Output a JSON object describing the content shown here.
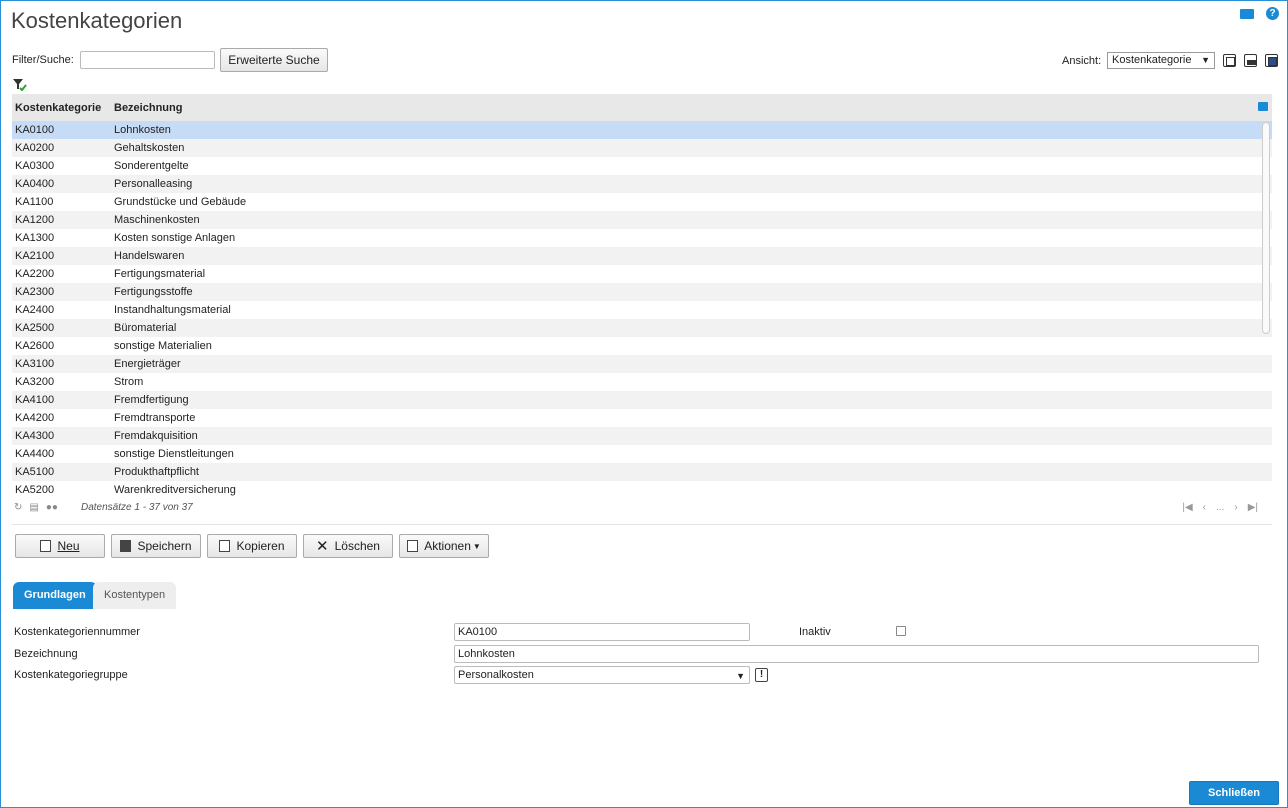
{
  "page": {
    "title": "Kostenkategorien"
  },
  "toolbar": {
    "filter_label": "Filter/Suche:",
    "filter_value": "",
    "advanced_search": "Erweiterte Suche",
    "view_label": "Ansicht:",
    "view_value": "Kostenkategorie"
  },
  "grid": {
    "headers": [
      "Kostenkategorie",
      "Bezeichnung"
    ],
    "rows": [
      [
        "KA0100",
        "Lohnkosten"
      ],
      [
        "KA0200",
        "Gehaltskosten"
      ],
      [
        "KA0300",
        "Sonderentgelte"
      ],
      [
        "KA0400",
        "Personalleasing"
      ],
      [
        "KA1100",
        "Grundstücke und Gebäude"
      ],
      [
        "KA1200",
        "Maschinenkosten"
      ],
      [
        "KA1300",
        "Kosten sonstige Anlagen"
      ],
      [
        "KA2100",
        "Handelswaren"
      ],
      [
        "KA2200",
        "Fertigungsmaterial"
      ],
      [
        "KA2300",
        "Fertigungsstoffe"
      ],
      [
        "KA2400",
        "Instandhaltungsmaterial"
      ],
      [
        "KA2500",
        "Büromaterial"
      ],
      [
        "KA2600",
        "sonstige Materialien"
      ],
      [
        "KA3100",
        "Energieträger"
      ],
      [
        "KA3200",
        "Strom"
      ],
      [
        "KA4100",
        "Fremdfertigung"
      ],
      [
        "KA4200",
        "Fremdtransporte"
      ],
      [
        "KA4300",
        "Fremdakquisition"
      ],
      [
        "KA4400",
        "sonstige Dienstleitungen"
      ],
      [
        "KA5100",
        "Produkthaftpflicht"
      ],
      [
        "KA5200",
        "Warenkreditversicherung"
      ]
    ],
    "selected_index": 0,
    "pager_info": "Datensätze 1 - 37 von 37",
    "pager_ellipsis": "..."
  },
  "actions": {
    "new": "Neu",
    "save": "Speichern",
    "copy": "Kopieren",
    "delete": "Löschen",
    "actions": "Aktionen"
  },
  "tabs": {
    "basics": "Grundlagen",
    "cost_types": "Kostentypen"
  },
  "form": {
    "number_label": "Kostenkategoriennummer",
    "number_value": "KA0100",
    "inactive_label": "Inaktiv",
    "name_label": "Bezeichnung",
    "name_value": "Lohnkosten",
    "group_label": "Kostenkategoriegruppe",
    "group_value": "Personalkosten"
  },
  "footer": {
    "close": "Schließen"
  },
  "colors": {
    "accent": "#1a8ad4",
    "selected_row": "#c6dcf6"
  }
}
